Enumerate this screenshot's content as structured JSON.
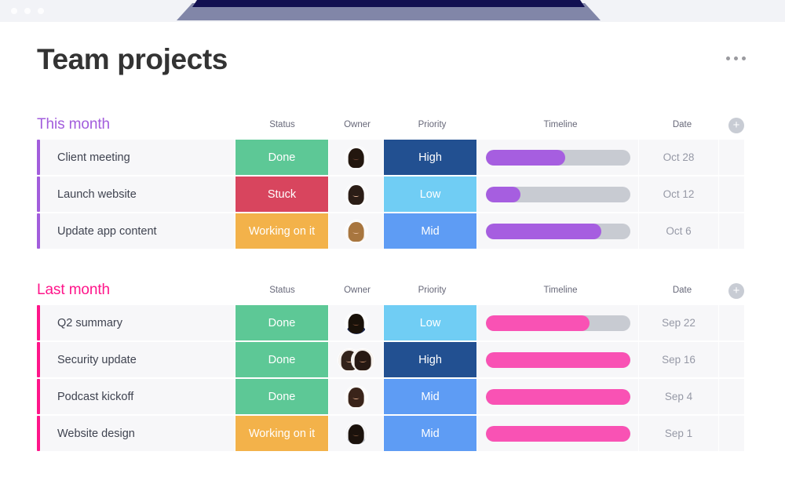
{
  "window": {
    "traffic_light_count": 3
  },
  "header": {
    "title": "Team projects",
    "menu_icon": "kebab-menu-icon"
  },
  "columns": {
    "status": "Status",
    "owner": "Owner",
    "priority": "Priority",
    "timeline": "Timeline",
    "date": "Date",
    "add": "+"
  },
  "colors": {
    "this_month_accent": "#a25ddc",
    "last_month_accent": "#ff158a",
    "status_done": "#5dc896",
    "status_stuck": "#d8455e",
    "status_working": "#f3b24a",
    "priority_high": "#225091",
    "priority_mid": "#5e9cf4",
    "priority_low": "#70cdf4",
    "timeline_purple": "#a65ee0",
    "timeline_pink": "#f952b4",
    "timeline_track": "#c8cbd2",
    "row_bg": "#f7f7f9"
  },
  "groups": [
    {
      "name": "This month",
      "accent": "#a25ddc",
      "timeline_color": "#a65ee0",
      "rows": [
        {
          "name": "Client meeting",
          "status": "Done",
          "status_class": "st-done",
          "owner_avatars": [
            {
              "skin": "#6b4332",
              "hair": "#23170f",
              "shirt": "#f3f3f5",
              "bg": "#fbfbfc"
            }
          ],
          "priority": "High",
          "priority_class": "pr-high",
          "timeline_percent": 55,
          "date": "Oct 28"
        },
        {
          "name": "Launch website",
          "status": "Stuck",
          "status_class": "st-stuck",
          "owner_avatars": [
            {
              "skin": "#e6b89b",
              "hair": "#2b1d16",
              "shirt": "#ffffff",
              "bg": "#fafafb"
            }
          ],
          "priority": "Low",
          "priority_class": "pr-low",
          "timeline_percent": 24,
          "date": "Oct 12"
        },
        {
          "name": "Update app content",
          "status": "Working on it",
          "status_class": "st-working",
          "owner_avatars": [
            {
              "skin": "#f0c4a4",
              "hair": "#a8763f",
              "shirt": "#f6ece2",
              "bg": "#fbfbfc"
            }
          ],
          "priority": "Mid",
          "priority_class": "pr-mid",
          "timeline_percent": 80,
          "date": "Oct 6"
        }
      ]
    },
    {
      "name": "Last month",
      "accent": "#ff158a",
      "timeline_color": "#f952b4",
      "rows": [
        {
          "name": "Q2 summary",
          "status": "Done",
          "status_class": "st-done",
          "owner_avatars": [
            {
              "skin": "#7a4a31",
              "hair": "#191109",
              "shirt": "#1d2a55",
              "bg": "#fdfdfd"
            }
          ],
          "priority": "Low",
          "priority_class": "pr-low",
          "timeline_percent": 72,
          "date": "Sep 22"
        },
        {
          "name": "Security update",
          "status": "Done",
          "status_class": "st-done",
          "owner_avatars": [
            {
              "skin": "#e0ac8a",
              "hair": "#33231a",
              "shirt": "#efe7df",
              "bg": "#f7f2ee"
            },
            {
              "skin": "#c98f6b",
              "hair": "#271913",
              "shirt": "#e7ddd4",
              "bg": "#f6f1ec"
            }
          ],
          "priority": "High",
          "priority_class": "pr-high",
          "timeline_percent": 100,
          "date": "Sep 16"
        },
        {
          "name": "Podcast kickoff",
          "status": "Done",
          "status_class": "st-done",
          "owner_avatars": [
            {
              "skin": "#e8b392",
              "hair": "#3a241a",
              "shirt": "#f4eee9",
              "bg": "#fdfcfb"
            }
          ],
          "priority": "Mid",
          "priority_class": "pr-mid",
          "timeline_percent": 100,
          "date": "Sep 4"
        },
        {
          "name": "Website design",
          "status": "Working on it",
          "status_class": "st-working",
          "owner_avatars": [
            {
              "skin": "#6f4a33",
              "hair": "#1b120c",
              "shirt": "#c9ccd4",
              "bg": "#f4f4f6"
            }
          ],
          "priority": "Mid",
          "priority_class": "pr-mid",
          "timeline_percent": 100,
          "date": "Sep 1"
        }
      ]
    }
  ]
}
